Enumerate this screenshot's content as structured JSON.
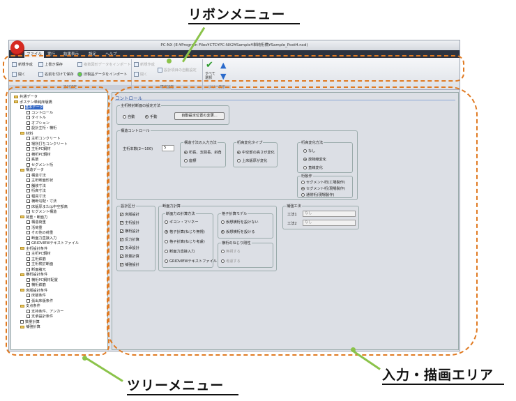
{
  "callouts": {
    "ribbon": "リボンメニュー",
    "tree": "ツリーメニュー",
    "area": "入力・描画エリア"
  },
  "window": {
    "title": "PC-NX (E:¥Program Files¥CTC¥PC-NX2¥Sample¥単純桁橋¥Sample_PostH.nxd)"
  },
  "tabs": [
    "ファイル",
    "実行",
    "結果表示",
    "設定",
    "ヘルプ"
  ],
  "ribbon": {
    "new": "新規作成",
    "save": "上書き保存",
    "open": "開く",
    "saveas": "名前を付けて保存",
    "import_disabled": "複数図形データをインポート",
    "import": "旧製品データをインポート",
    "run_disabled": "新規作成",
    "run2_disabled": "開く",
    "reset": "設計項目の自動設定",
    "all_select": "すべて選択",
    "groups": [
      "設計設定",
      "環境設定",
      "ツリー表示"
    ]
  },
  "tree": [
    {
      "label": "共通データ",
      "level": 0,
      "type": "folder"
    },
    {
      "label": "ポステン単純床版橋",
      "level": 0,
      "type": "folder"
    },
    {
      "label": "基本データ",
      "level": 1,
      "type": "check"
    },
    {
      "label": "コントロール",
      "level": 2,
      "type": "check"
    },
    {
      "label": "タイトル",
      "level": 2,
      "type": "check"
    },
    {
      "label": "オプション",
      "level": 2,
      "type": "check"
    },
    {
      "label": "設計主桁・横桁",
      "level": 2,
      "type": "check"
    },
    {
      "label": "材料",
      "level": 1,
      "type": "folder"
    },
    {
      "label": "主桁コンクリート",
      "level": 2,
      "type": "check"
    },
    {
      "label": "場所打ちコンクリート",
      "level": 2,
      "type": "check"
    },
    {
      "label": "主桁PC鋼材",
      "level": 2,
      "type": "check"
    },
    {
      "label": "横桁PC鋼材",
      "level": 2,
      "type": "check"
    },
    {
      "label": "鉄筋",
      "level": 2,
      "type": "check"
    },
    {
      "label": "セグメント桁",
      "level": 2,
      "type": "check"
    },
    {
      "label": "構造データ",
      "level": 1,
      "type": "folder"
    },
    {
      "label": "構造寸法",
      "level": 2,
      "type": "check"
    },
    {
      "label": "主桁断面形状",
      "level": 2,
      "type": "check"
    },
    {
      "label": "舗装寸法",
      "level": 2,
      "type": "check"
    },
    {
      "label": "桁高寸法",
      "level": 2,
      "type": "check"
    },
    {
      "label": "幅員寸法",
      "level": 2,
      "type": "check"
    },
    {
      "label": "横断勾配・寸法",
      "level": 2,
      "type": "check"
    },
    {
      "label": "床版厚または中空部高",
      "level": 2,
      "type": "check"
    },
    {
      "label": "セグメント構造",
      "level": 2,
      "type": "check"
    },
    {
      "label": "荷重・断面力",
      "level": 1,
      "type": "folder"
    },
    {
      "label": "構造荷重",
      "level": 2,
      "type": "check"
    },
    {
      "label": "活荷重",
      "level": 2,
      "type": "check"
    },
    {
      "label": "その他の荷重",
      "level": 2,
      "type": "check"
    },
    {
      "label": "断面力直接入力",
      "level": 2,
      "type": "check"
    },
    {
      "label": "GRIDVIEWテキストファイル",
      "level": 2,
      "type": "check"
    },
    {
      "label": "主桁設計条件",
      "level": 1,
      "type": "folder"
    },
    {
      "label": "主桁PC鋼材",
      "level": 2,
      "type": "check"
    },
    {
      "label": "主桁鉄筋",
      "level": 2,
      "type": "check"
    },
    {
      "label": "主桁検討断面",
      "level": 2,
      "type": "check"
    },
    {
      "label": "断面諸元",
      "level": 2,
      "type": "check"
    },
    {
      "label": "横桁設計条件",
      "level": 1,
      "type": "folder"
    },
    {
      "label": "横桁PC鋼材配置",
      "level": 2,
      "type": "check"
    },
    {
      "label": "横桁鉄筋",
      "level": 2,
      "type": "check"
    },
    {
      "label": "床版設計条件",
      "level": 1,
      "type": "folder"
    },
    {
      "label": "床版条件",
      "level": 2,
      "type": "check"
    },
    {
      "label": "張出床版条件",
      "level": 2,
      "type": "check"
    },
    {
      "label": "支点条件",
      "level": 1,
      "type": "folder"
    },
    {
      "label": "支持条件、アンカー",
      "level": 2,
      "type": "check"
    },
    {
      "label": "支承設計条件",
      "level": 2,
      "type": "check"
    },
    {
      "label": "数量計算",
      "level": 1,
      "type": "check"
    },
    {
      "label": "補強計算",
      "level": 1,
      "type": "folder"
    }
  ],
  "main": {
    "header": "コントロール",
    "g1": {
      "title": "主桁検討断面の設定方法",
      "auto": "自動",
      "manual": "手動",
      "btn": "自動設定位置の変更..."
    },
    "g2": {
      "title": "構造コントロール",
      "span_label": "主桁本数(2～100)",
      "span_value": "5",
      "g2a": {
        "title": "構造寸法の入力方法",
        "o1": "桁長、支間長、斜角",
        "o2": "座標"
      },
      "g2b": {
        "title": "桁高変化タイプ",
        "o1": "中空部の高さが変化",
        "o2": "上床版厚が変化"
      },
      "g2c": {
        "title": "桁高変化方法",
        "o1": "なし",
        "o2": "放物線変化",
        "o3": "直線変化"
      },
      "g2d": {
        "title": "桁製作",
        "o1": "セグメント桁(工場製作)",
        "o2": "セグメント桁(現場製作)",
        "o3": "通常桁(現場製作)"
      }
    },
    "g3": {
      "title": "設計区分",
      "items": [
        "床版設計",
        "主桁設計",
        "横桁設計",
        "反力計算",
        "支承設計",
        "数量計算",
        "補強設計"
      ]
    },
    "g4": {
      "title": "断面力計算",
      "g4a": {
        "title": "断面力の計算方法",
        "o1": "ギヨン・マソネー",
        "o2": "格子計算(ねじり無視)",
        "o3": "格子計算(ねじり考慮)",
        "o4": "断面力直接入力",
        "o5": "GRIDVIEWテキストファイル"
      },
      "g4b": {
        "title": "格子計算モデル",
        "o1": "仮想横桁を設けない",
        "o2": "仮想横桁を設ける"
      },
      "g4c": {
        "title": "横桁のねじり剛性",
        "o1": "無視する",
        "o2": "考慮する"
      }
    },
    "g5": {
      "title": "補強工法",
      "r1": "工法1",
      "r2": "工法2",
      "v1": "なし",
      "v2": "なし"
    }
  },
  "colors": {
    "accent": "#e07a22",
    "ribbon_tab_bar": "#2d3440"
  }
}
